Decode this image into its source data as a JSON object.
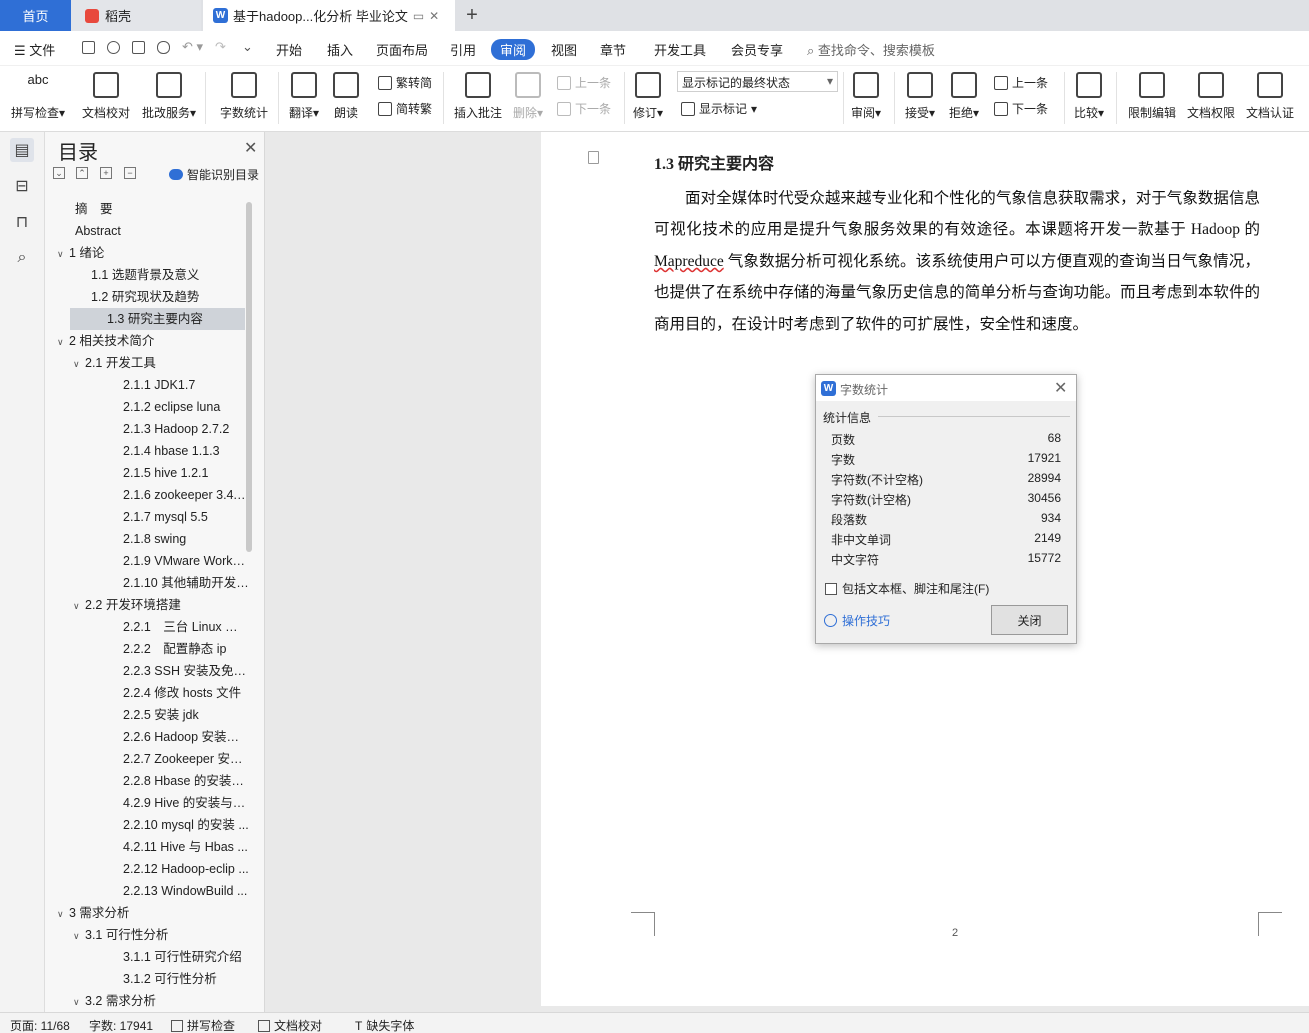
{
  "tabs": {
    "home": "首页",
    "daoke": "稻壳",
    "doc": "基于hadoop...化分析 毕业论文",
    "add": "+"
  },
  "menu": {
    "file": "文件",
    "items": [
      "开始",
      "插入",
      "页面布局",
      "引用",
      "审阅",
      "视图",
      "章节",
      "开发工具",
      "会员专享"
    ],
    "active": "审阅",
    "search": "查找命令、搜索模板"
  },
  "ribbon": {
    "spell": "拼写检查",
    "proofread": "文档校对",
    "review_service": "批改服务",
    "word_count": "字数统计",
    "translate": "翻译",
    "read_aloud": "朗读",
    "trad_to_simp": "繁转简",
    "simp_to_trad": "简转繁",
    "insert_comment": "插入批注",
    "delete": "删除",
    "prev_comment": "上一条",
    "next_comment": "下一条",
    "revise": "修订",
    "markup_state": "显示标记的最终状态",
    "show_markup": "显示标记",
    "review": "审阅",
    "accept": "接受",
    "reject": "拒绝",
    "prev_change": "上一条",
    "next_change": "下一条",
    "compare": "比较",
    "restrict_edit": "限制编辑",
    "doc_permission": "文档权限",
    "doc_auth": "文档认证"
  },
  "toc": {
    "title": "目录",
    "smart": "智能识别目录",
    "items": [
      {
        "text": "摘　要",
        "level": 1,
        "caret": ""
      },
      {
        "text": "Abstract",
        "level": 1,
        "caret": ""
      },
      {
        "text": "1 绪论",
        "level": 1,
        "caret": "v"
      },
      {
        "text": "1.1 选题背景及意义",
        "level": 2,
        "caret": ""
      },
      {
        "text": "1.2 研究现状及趋势",
        "level": 2,
        "caret": ""
      },
      {
        "text": "1.3 研究主要内容",
        "level": 2,
        "caret": "",
        "selected": true
      },
      {
        "text": "2 相关技术简介",
        "level": 1,
        "caret": "v"
      },
      {
        "text": "2.1 开发工具",
        "level": 2,
        "caret": "v"
      },
      {
        "text": "2.1.1 JDK1.7",
        "level": 3,
        "caret": ""
      },
      {
        "text": "2.1.2 eclipse luna",
        "level": 3,
        "caret": ""
      },
      {
        "text": "2.1.3 Hadoop 2.7.2",
        "level": 3,
        "caret": ""
      },
      {
        "text": "2.1.4 hbase 1.1.3",
        "level": 3,
        "caret": ""
      },
      {
        "text": "2.1.5 hive 1.2.1",
        "level": 3,
        "caret": ""
      },
      {
        "text": "2.1.6 zookeeper 3.4. ...",
        "level": 3,
        "caret": ""
      },
      {
        "text": "2.1.7 mysql 5.5",
        "level": 3,
        "caret": ""
      },
      {
        "text": "2.1.8 swing",
        "level": 3,
        "caret": ""
      },
      {
        "text": "2.1.9 VMware Works ...",
        "level": 3,
        "caret": ""
      },
      {
        "text": "2.1.10 其他辅助开发 ...",
        "level": 3,
        "caret": ""
      },
      {
        "text": "2.2 开发环境搭建",
        "level": 2,
        "caret": "v"
      },
      {
        "text": "2.2.1　三台 Linux 虚拟 ...",
        "level": 3,
        "caret": ""
      },
      {
        "text": "2.2.2　配置静态 ip",
        "level": 3,
        "caret": ""
      },
      {
        "text": "2.2.3 SSH 安装及免密 ...",
        "level": 3,
        "caret": ""
      },
      {
        "text": "2.2.4 修改 hosts 文件",
        "level": 3,
        "caret": ""
      },
      {
        "text": "2.2.5 安装 jdk",
        "level": 3,
        "caret": ""
      },
      {
        "text": "2.2.6 Hadoop 安装与 ...",
        "level": 3,
        "caret": ""
      },
      {
        "text": "2.2.7 Zookeeper 安装 ...",
        "level": 3,
        "caret": ""
      },
      {
        "text": "2.2.8 Hbase 的安装与 ...",
        "level": 3,
        "caret": ""
      },
      {
        "text": "4.2.9 Hive 的安装与配 ...",
        "level": 3,
        "caret": ""
      },
      {
        "text": "2.2.10 mysql 的安装 ...",
        "level": 3,
        "caret": ""
      },
      {
        "text": "4.2.11 Hive 与 Hbas ...",
        "level": 3,
        "caret": ""
      },
      {
        "text": "2.2.12 Hadoop-eclip ...",
        "level": 3,
        "caret": ""
      },
      {
        "text": "2.2.13 WindowBuild ...",
        "level": 3,
        "caret": ""
      },
      {
        "text": "3  需求分析",
        "level": 1,
        "caret": "v"
      },
      {
        "text": "3.1 可行性分析",
        "level": 2,
        "caret": "v"
      },
      {
        "text": "3.1.1 可行性研究介绍",
        "level": 3,
        "caret": ""
      },
      {
        "text": "3.1.2 可行性分析",
        "level": 3,
        "caret": ""
      },
      {
        "text": "3.2 需求分析",
        "level": 2,
        "caret": "v"
      }
    ]
  },
  "document": {
    "heading": "1.3 研究主要内容",
    "paragraph_before": "面对全媒体时代受众越来越专业化和个性化的气象信息获取需求，对于气象数据信息可视化技术的应用是提升气象服务效果的有效途径。本课题将开发一款基于 Hadoop 的 ",
    "underlined_word": "Mapreduce",
    "paragraph_after": " 气象数据分析可视化系统。该系统使用户可以方便直观的查询当日气象情况，也提供了在系统中存储的海量气象历史信息的简单分析与查询功能。而且考虑到本软件的商用目的，在设计时考虑到了软件的可扩展性，安全性和速度。",
    "page_number": "2"
  },
  "dialog": {
    "title": "字数统计",
    "group": "统计信息",
    "rows": [
      {
        "label": "页数",
        "value": "68"
      },
      {
        "label": "字数",
        "value": "17921"
      },
      {
        "label": "字符数(不计空格)",
        "value": "28994"
      },
      {
        "label": "字符数(计空格)",
        "value": "30456"
      },
      {
        "label": "段落数",
        "value": "934"
      },
      {
        "label": "非中文单词",
        "value": "2149"
      },
      {
        "label": "中文字符",
        "value": "15772"
      }
    ],
    "include_label": "包括文本框、脚注和尾注(F)",
    "include_checked": false,
    "tips": "操作技巧",
    "close": "关闭"
  },
  "status": {
    "page": "页面: 11/68",
    "words": "字数: 17941",
    "spell": "拼写检查",
    "proofread": "文档校对",
    "missing_font": "缺失字体"
  },
  "colors": {
    "accent": "#2f6fd6",
    "selected_toc": "#cfd3d9"
  }
}
